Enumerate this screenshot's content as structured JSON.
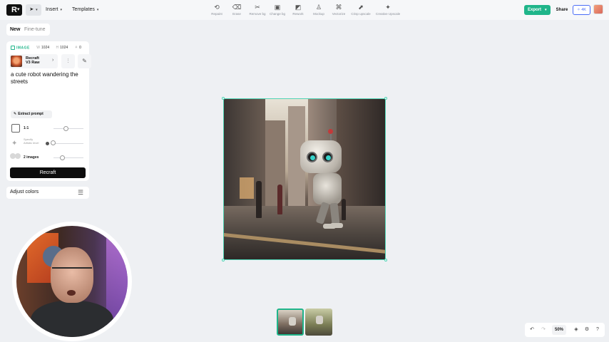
{
  "toolbar": {
    "logo": "R",
    "menu_insert": "Insert",
    "menu_templates": "Templates",
    "tools": [
      {
        "icon": "lasso-icon",
        "label": "Repaint",
        "glyph": "⟲"
      },
      {
        "icon": "eraser-icon",
        "label": "Erase",
        "glyph": "⌫"
      },
      {
        "icon": "scissors-icon",
        "label": "Remove bg",
        "glyph": "✂"
      },
      {
        "icon": "image-swap-icon",
        "label": "Change bg",
        "glyph": "▣"
      },
      {
        "icon": "variations-icon",
        "label": "Rework",
        "glyph": "◩"
      },
      {
        "icon": "mockup-icon",
        "label": "Mockup",
        "glyph": "♙"
      },
      {
        "icon": "vector-icon",
        "label": "Vectorize",
        "glyph": "⌘"
      },
      {
        "icon": "upscale-icon",
        "label": "Crisp upscale",
        "glyph": "⬈"
      },
      {
        "icon": "creative-upscale-icon",
        "label": "Creative Upscale",
        "glyph": "✦"
      }
    ],
    "export_label": "Export",
    "share_label": "Share",
    "resolution_label": "4K",
    "accent_color": "#1fb58a"
  },
  "panel": {
    "tab_new": "New",
    "tab_finetune": "Fine-tune",
    "type_label": "IMAGE",
    "width": "1024",
    "height": "1024",
    "count_value": "0",
    "model_name_line1": "Recraft",
    "model_name_line2": "V3 Raw",
    "prompt": "a cute robot wandering the streets",
    "extract_label": "Extract prompt",
    "ratio_label": "1:1",
    "style_label": "Specify Artistic level",
    "images_label": "2 images",
    "recraft_label": "Recraft",
    "adjust_colors_label": "Adjust colors"
  },
  "zoom": {
    "level": "50%"
  }
}
